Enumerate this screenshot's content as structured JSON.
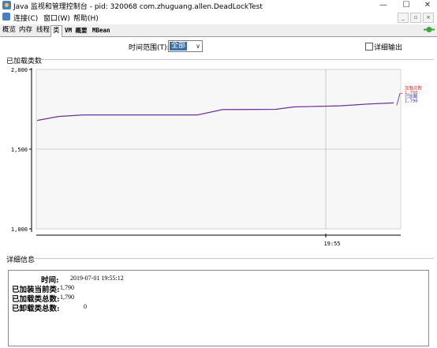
{
  "window": {
    "title": "Java 监视和管理控制台 - pid: 320068 com.zhuguang.allen.DeadLockTest"
  },
  "menu": {
    "items": [
      "连接(C)",
      "窗口(W)",
      "帮助(H)"
    ]
  },
  "tabs": [
    {
      "label": "概览",
      "active": false
    },
    {
      "label": "内存",
      "active": false
    },
    {
      "label": "线程",
      "active": false
    },
    {
      "label": "类",
      "active": true
    },
    {
      "label": "VM 概要",
      "active": false
    },
    {
      "label": "MBean",
      "active": false
    }
  ],
  "controls": {
    "time_range_label": "时间范围(T):",
    "time_range_value": "全部",
    "verbose_label": "详细输出"
  },
  "chart_section_title": "已加载类数",
  "chart_data": {
    "type": "line",
    "ylim": [
      1000,
      2000
    ],
    "yticks": [
      "1,000",
      "1,500",
      "2,000"
    ],
    "xtick_label": "19:55",
    "grid": true,
    "series": [
      {
        "name": "加载总数",
        "color": "#e03030",
        "points": [
          [
            0,
            1680
          ],
          [
            6,
            1705
          ],
          [
            13,
            1715
          ],
          [
            45,
            1715
          ],
          [
            52,
            1748
          ],
          [
            67,
            1750
          ],
          [
            72,
            1765
          ],
          [
            85,
            1772
          ],
          [
            93,
            1783
          ],
          [
            100,
            1790
          ]
        ]
      },
      {
        "name": "已加载",
        "color": "#3030d0",
        "points": [
          [
            0,
            1680
          ],
          [
            6,
            1705
          ],
          [
            13,
            1715
          ],
          [
            45,
            1715
          ],
          [
            52,
            1748
          ],
          [
            67,
            1750
          ],
          [
            72,
            1765
          ],
          [
            85,
            1772
          ],
          [
            93,
            1783
          ],
          [
            100,
            1790
          ]
        ]
      }
    ],
    "legend": [
      {
        "label": "加载总数",
        "value": "1,790",
        "color": "#e03030"
      },
      {
        "label": "已加载",
        "value": "1,790",
        "color": "#3030d0"
      }
    ]
  },
  "details": {
    "title": "详细信息",
    "rows": [
      {
        "label": "时间:",
        "value": "2019-07-01 19:55:12"
      },
      {
        "label": "已加装当前类:",
        "value": "1,790"
      },
      {
        "label": "已加载类总数:",
        "value": "1,790"
      },
      {
        "label": "已卸载类总数:",
        "value": "0"
      }
    ]
  }
}
